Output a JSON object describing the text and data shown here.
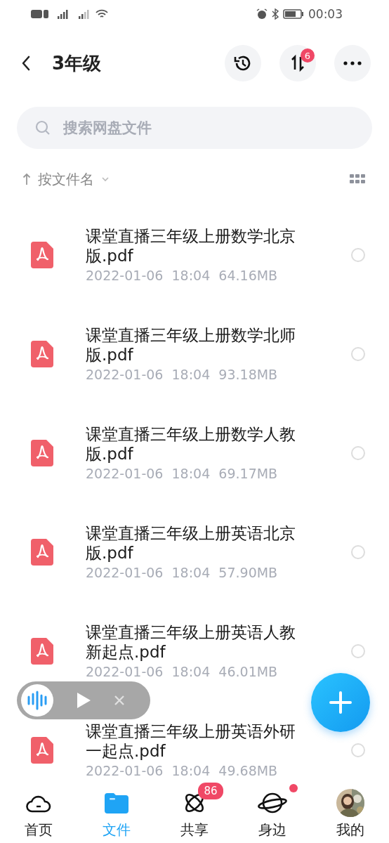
{
  "status_bar": {
    "time": "00:03"
  },
  "header": {
    "title": "3年级",
    "transfer_badge": "6"
  },
  "search": {
    "placeholder": "搜索网盘文件"
  },
  "sort": {
    "label": "按文件名"
  },
  "files": [
    {
      "name": "课堂直播三年级上册数学北京版.pdf",
      "date": "2022-01-06",
      "time": "18:04",
      "size": "64.16MB",
      "selected": false
    },
    {
      "name": "课堂直播三年级上册数学北师版.pdf",
      "date": "2022-01-06",
      "time": "18:04",
      "size": "93.18MB",
      "selected": false
    },
    {
      "name": "课堂直播三年级上册数学人教版.pdf",
      "date": "2022-01-06",
      "time": "18:04",
      "size": "69.17MB",
      "selected": false
    },
    {
      "name": "课堂直播三年级上册英语北京版.pdf",
      "date": "2022-01-06",
      "time": "18:04",
      "size": "57.90MB",
      "selected": false
    },
    {
      "name": "课堂直播三年级上册英语人教新起点.pdf",
      "date": "2022-01-06",
      "time": "18:04",
      "size": "46.01MB",
      "selected": false
    },
    {
      "name": "课堂直播三年级上册英语外研一起点.pdf",
      "date": "2022-01-06",
      "time": "18:04",
      "size": "49.68MB",
      "selected": false
    }
  ],
  "nav": [
    {
      "kind": "home",
      "label": "首页",
      "selected": false
    },
    {
      "kind": "files",
      "label": "文件",
      "selected": true
    },
    {
      "kind": "share",
      "label": "共享",
      "selected": false,
      "badge": "86"
    },
    {
      "kind": "planet",
      "label": "身边",
      "selected": false,
      "dot": true
    },
    {
      "kind": "avatar",
      "label": "我的",
      "selected": false
    }
  ]
}
